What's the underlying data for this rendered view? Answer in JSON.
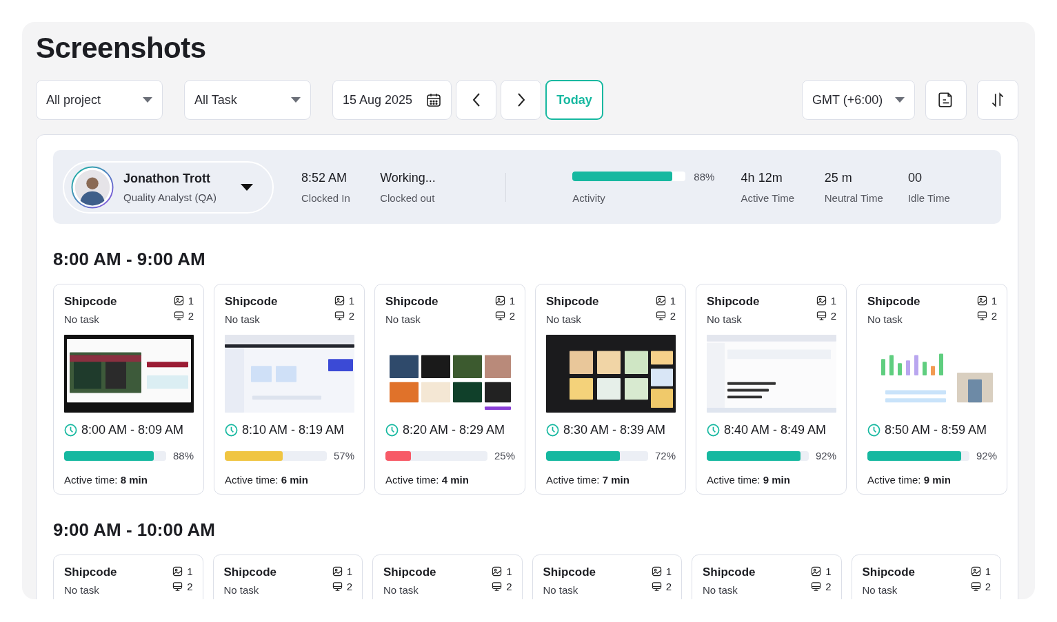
{
  "title": "Screenshots",
  "filters": {
    "project": "All project",
    "task": "All Task",
    "date": "15 Aug 2025",
    "today": "Today",
    "timezone": "GMT (+6:00)"
  },
  "user": {
    "name": "Jonathon Trott",
    "role": "Quality Analyst (QA)",
    "stats": [
      {
        "value": "8:52 AM",
        "label": "Clocked In"
      },
      {
        "value": "Working...",
        "label": "Clocked out"
      }
    ],
    "activity": {
      "level": 0.88,
      "reading": "88%",
      "label": "Activity"
    },
    "times": [
      {
        "value": "4h 12m",
        "label": "Active Time"
      },
      {
        "value": "25 m",
        "label": "Neutral Time"
      },
      {
        "value": "00",
        "label": "Idle Time"
      }
    ]
  },
  "sections": [
    {
      "heading": "8:00 AM - 9:00 AM",
      "cards": [
        {
          "project": "Shipcode",
          "task": "No task",
          "images": "1",
          "screens": "2",
          "time": "8:00 AM - 8:09 AM",
          "level": 0.88,
          "color": "#16b8a0",
          "reading": "88%",
          "active": "Active time: **8 min**"
        },
        {
          "project": "Shipcode",
          "task": "No task",
          "images": "1",
          "screens": "2",
          "time": "8:10 AM - 8:19 AM",
          "level": 0.57,
          "color": "#f0c542",
          "reading": "57%",
          "active": "Active time: **6 min**"
        },
        {
          "project": "Shipcode",
          "task": "No task",
          "images": "1",
          "screens": "2",
          "time": "8:20 AM - 8:29 AM",
          "level": 0.25,
          "color": "#f75a67",
          "reading": "25%",
          "active": "Active time: **4 min**"
        },
        {
          "project": "Shipcode",
          "task": "No task",
          "images": "1",
          "screens": "2",
          "time": "8:30 AM - 8:39 AM",
          "level": 0.72,
          "color": "#16b8a0",
          "reading": "72%",
          "active": "Active time: **7 min**"
        },
        {
          "project": "Shipcode",
          "task": "No task",
          "images": "1",
          "screens": "2",
          "time": "8:40 AM - 8:49 AM",
          "level": 0.92,
          "color": "#16b8a0",
          "reading": "92%",
          "active": "Active time: **9 min**"
        },
        {
          "project": "Shipcode",
          "task": "No task",
          "images": "1",
          "screens": "2",
          "time": "8:50 AM - 8:59 AM",
          "level": 0.92,
          "color": "#16b8a0",
          "reading": "92%",
          "active": "Active time: **9 min**"
        }
      ]
    },
    {
      "heading": "9:00 AM - 10:00 AM",
      "cards": [
        {
          "project": "Shipcode",
          "task": "No task",
          "images": "1",
          "screens": "2"
        },
        {
          "project": "Shipcode",
          "task": "No task",
          "images": "1",
          "screens": "2"
        },
        {
          "project": "Shipcode",
          "task": "No task",
          "images": "1",
          "screens": "2"
        },
        {
          "project": "Shipcode",
          "task": "No task",
          "images": "1",
          "screens": "2"
        },
        {
          "project": "Shipcode",
          "task": "No task",
          "images": "1",
          "screens": "2"
        },
        {
          "project": "Shipcode",
          "task": "No task",
          "images": "1",
          "screens": "2"
        }
      ]
    }
  ]
}
